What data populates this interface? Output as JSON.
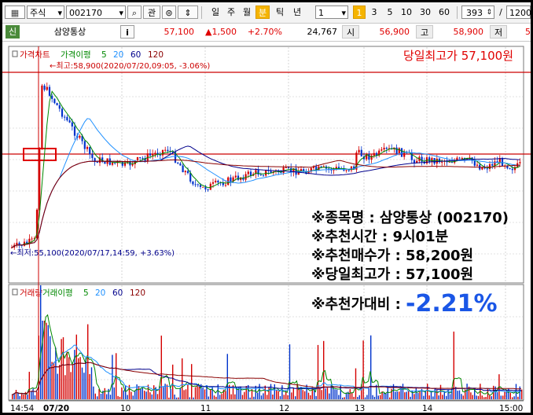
{
  "toolbar": {
    "market": "주식",
    "code": "002170",
    "btn_gwan": "관",
    "periods": [
      "일",
      "주",
      "월",
      "분",
      "틱",
      "년"
    ],
    "selected_period": "분",
    "interval_value": "1",
    "minute_options": [
      "1",
      "3",
      "5",
      "10",
      "30",
      "60"
    ],
    "selected_minute": "1",
    "count_value": "393",
    "slash": "/",
    "total_value": "1200"
  },
  "quote": {
    "badge": "신",
    "name": "삼양통상",
    "info_btn": "i",
    "price": "57,100",
    "change": "▲1,500",
    "change_pct": "+2.70%",
    "volume": "24,767",
    "open_label": "시",
    "open": "56,900",
    "high_label": "고",
    "high": "58,900",
    "low_label": "저",
    "low_partial": "5"
  },
  "price_panel": {
    "legend": [
      {
        "label": "가격차트",
        "color": "#cc0000"
      },
      {
        "label": "가격이평",
        "color": "#008800"
      },
      {
        "label": "5",
        "color": "#008800"
      },
      {
        "label": "20",
        "color": "#1e90ff"
      },
      {
        "label": "60",
        "color": "#00008b"
      },
      {
        "label": "120",
        "color": "#8b0000"
      }
    ],
    "high_annotation": "←최고:58,900(2020/07/20,09:05, -3.06%)",
    "low_annotation": "←최저:55,100(2020/07/17,14:59, +3.63%)",
    "day_high_label": "당일최고가 57,100원"
  },
  "volume_panel": {
    "legend": [
      {
        "label": "거래량",
        "color": "#cc0000"
      },
      {
        "label": "거래이평",
        "color": "#008800"
      },
      {
        "label": "5",
        "color": "#008800"
      },
      {
        "label": "20",
        "color": "#1e90ff"
      },
      {
        "label": "60",
        "color": "#00008b"
      },
      {
        "label": "120",
        "color": "#8b0000"
      }
    ]
  },
  "x_axis": {
    "ticks": [
      "14:54",
      "07/20",
      "10",
      "11",
      "12",
      "13",
      "14",
      "15:00"
    ]
  },
  "overlay": {
    "line1": "※종목명 : 삼양통상 (002170)",
    "line2": "※추천시간 : 9시01분",
    "line3": "※추천매수가 : 58,200원",
    "line4": "※당일최고가 : 57,100원",
    "line5_label": "※추천가대비 : ",
    "line5_value": "-2.21%",
    "value_color": "#1a56e6"
  }
}
